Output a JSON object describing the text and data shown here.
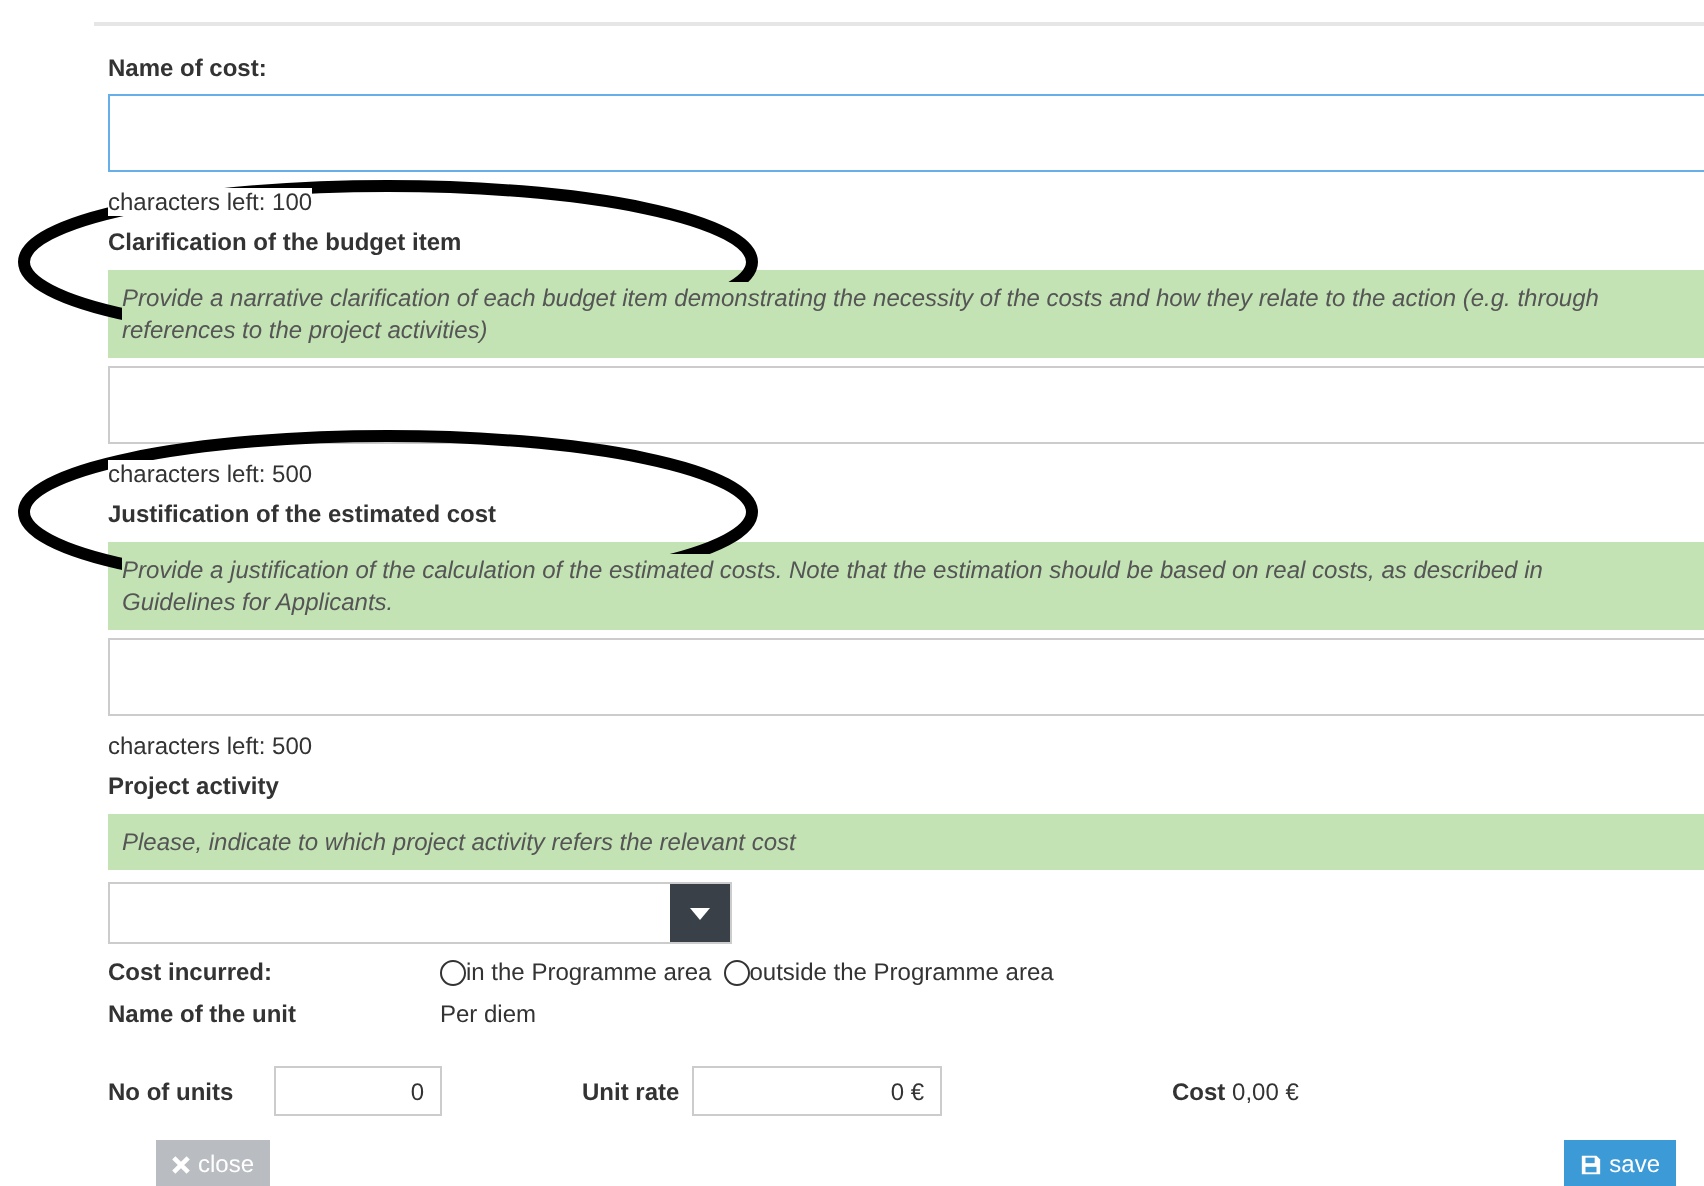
{
  "name_of_cost": {
    "label": "Name of cost:",
    "counter": "characters left: 100",
    "focused": true
  },
  "sections": [
    {
      "label": "Clarification of the budget item",
      "hint": "Provide a narrative clarification of each budget item demonstrating the necessity of the costs and how they relate to the action (e.g. through references to the project activities)",
      "counter": "characters left: 500"
    },
    {
      "label": "Justification of the estimated cost",
      "hint": "Provide a justification of the calculation of the estimated costs. Note that the estimation should be based on real costs, as described in Guidelines for Applicants.",
      "counter": "characters left: 500"
    }
  ],
  "project_activity": {
    "label": "Project activity",
    "hint": "Please, indicate to which project activity refers the relevant cost"
  },
  "cost_incurred": {
    "label": "Cost incurred:",
    "options": [
      {
        "label": "in the Programme area",
        "selected": false
      },
      {
        "label": "outside the Programme area",
        "selected": false
      }
    ]
  },
  "unit": {
    "label": "Name of the unit",
    "value": "Per diem"
  },
  "no_of_units": {
    "label": "No of units",
    "value": "0"
  },
  "unit_rate": {
    "label": "Unit rate",
    "value": "0 €"
  },
  "cost": {
    "label": "Cost",
    "value": "0,00 €"
  },
  "buttons": [
    {
      "kind": "close",
      "label": "close"
    },
    {
      "kind": "save",
      "label": "save"
    }
  ]
}
